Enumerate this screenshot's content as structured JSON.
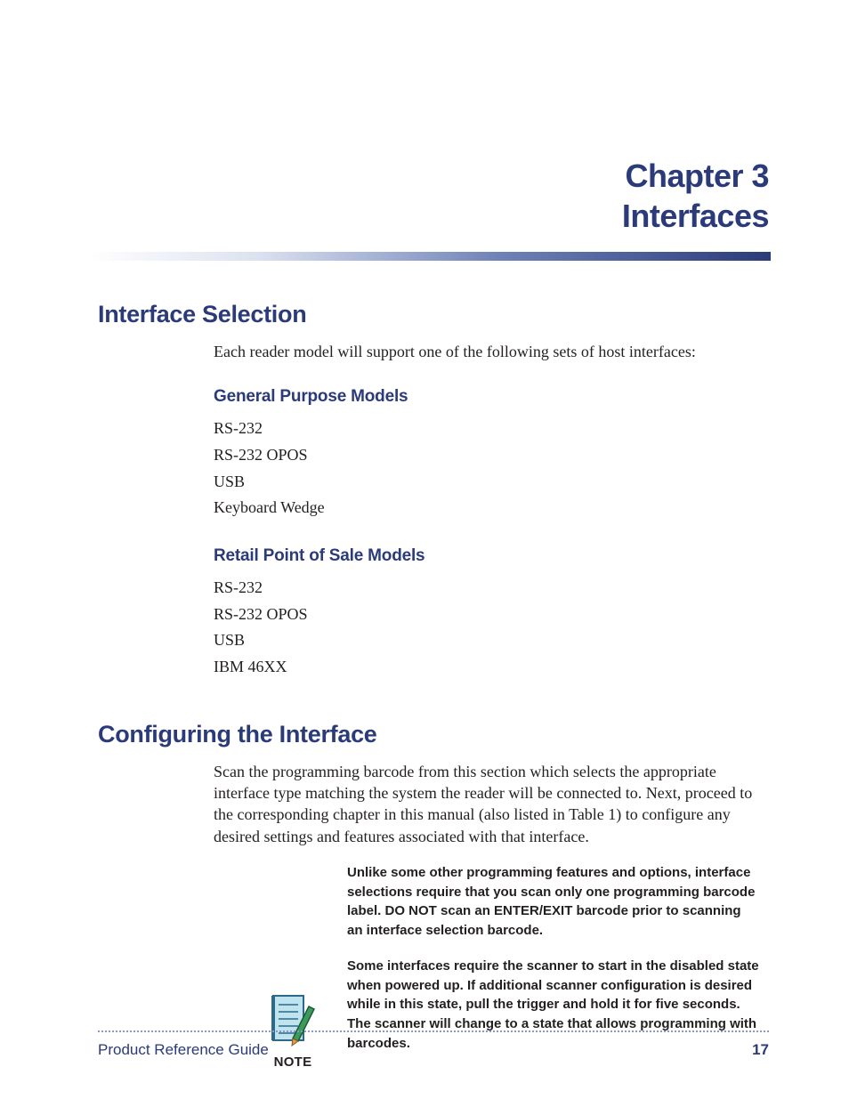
{
  "chapter": {
    "label": "Chapter 3",
    "title": "Interfaces"
  },
  "section1": {
    "heading": "Interface Selection",
    "intro": "Each reader model will support one of the following sets of host interfaces:",
    "groupA": {
      "heading": "General Purpose Models",
      "items": [
        "RS-232",
        "RS-232 OPOS",
        "USB",
        "Keyboard Wedge"
      ]
    },
    "groupB": {
      "heading": "Retail Point of Sale Models",
      "items": [
        "RS-232",
        "RS-232 OPOS",
        "USB",
        "IBM 46XX"
      ]
    }
  },
  "section2": {
    "heading": "Configuring the Interface",
    "body": "Scan the programming barcode from this section which selects the appropriate interface type matching the system the reader will be connected to. Next, proceed to the corresponding chapter in this manual (also listed in Table 1) to configure any desired settings and features associated with that interface.",
    "note_label": "NOTE",
    "note1": "Unlike some other programming features and options, interface selections require that you scan only one programming barcode label. DO NOT scan an ENTER/EXIT barcode prior to scanning an interface selection barcode.",
    "note2": "Some interfaces require the scanner to start in the disabled state when powered up. If additional scanner configuration is desired while in this state, pull the trigger and hold it for five seconds. The scanner will change to a state that allows programming with barcodes."
  },
  "footer": {
    "left": "Product Reference Guide",
    "right": "17"
  }
}
